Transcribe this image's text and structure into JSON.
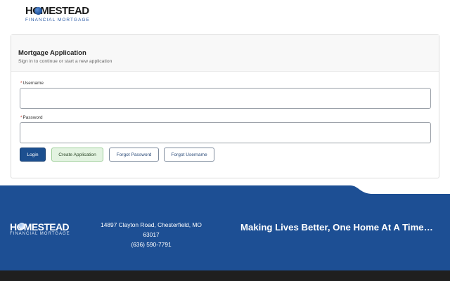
{
  "brand": {
    "name": "HOMESTEAD",
    "subtitle": "FINANCIAL MORTGAGE"
  },
  "card": {
    "title": "Mortgage Application",
    "subtitle": "Sign in to continue or start a new application"
  },
  "form": {
    "required_marker": "*",
    "username_label": "Username",
    "username_value": "",
    "password_label": "Password",
    "password_value": ""
  },
  "buttons": {
    "login": "Login",
    "create_application": "Create Application",
    "forgot_password": "Forgot Password",
    "forgot_username": "Forgot Username"
  },
  "footer": {
    "address": "14897 Clayton Road, Chesterfield, MO 63017",
    "phone": "(636) 590-7791",
    "tagline": "Making Lives Better, One Home At A Time…"
  },
  "colors": {
    "brand_blue": "#1c4f8f",
    "footer_blue": "#1d4f94",
    "create_green": "#e3f3e1",
    "footer_dark": "#1f1f1f"
  }
}
